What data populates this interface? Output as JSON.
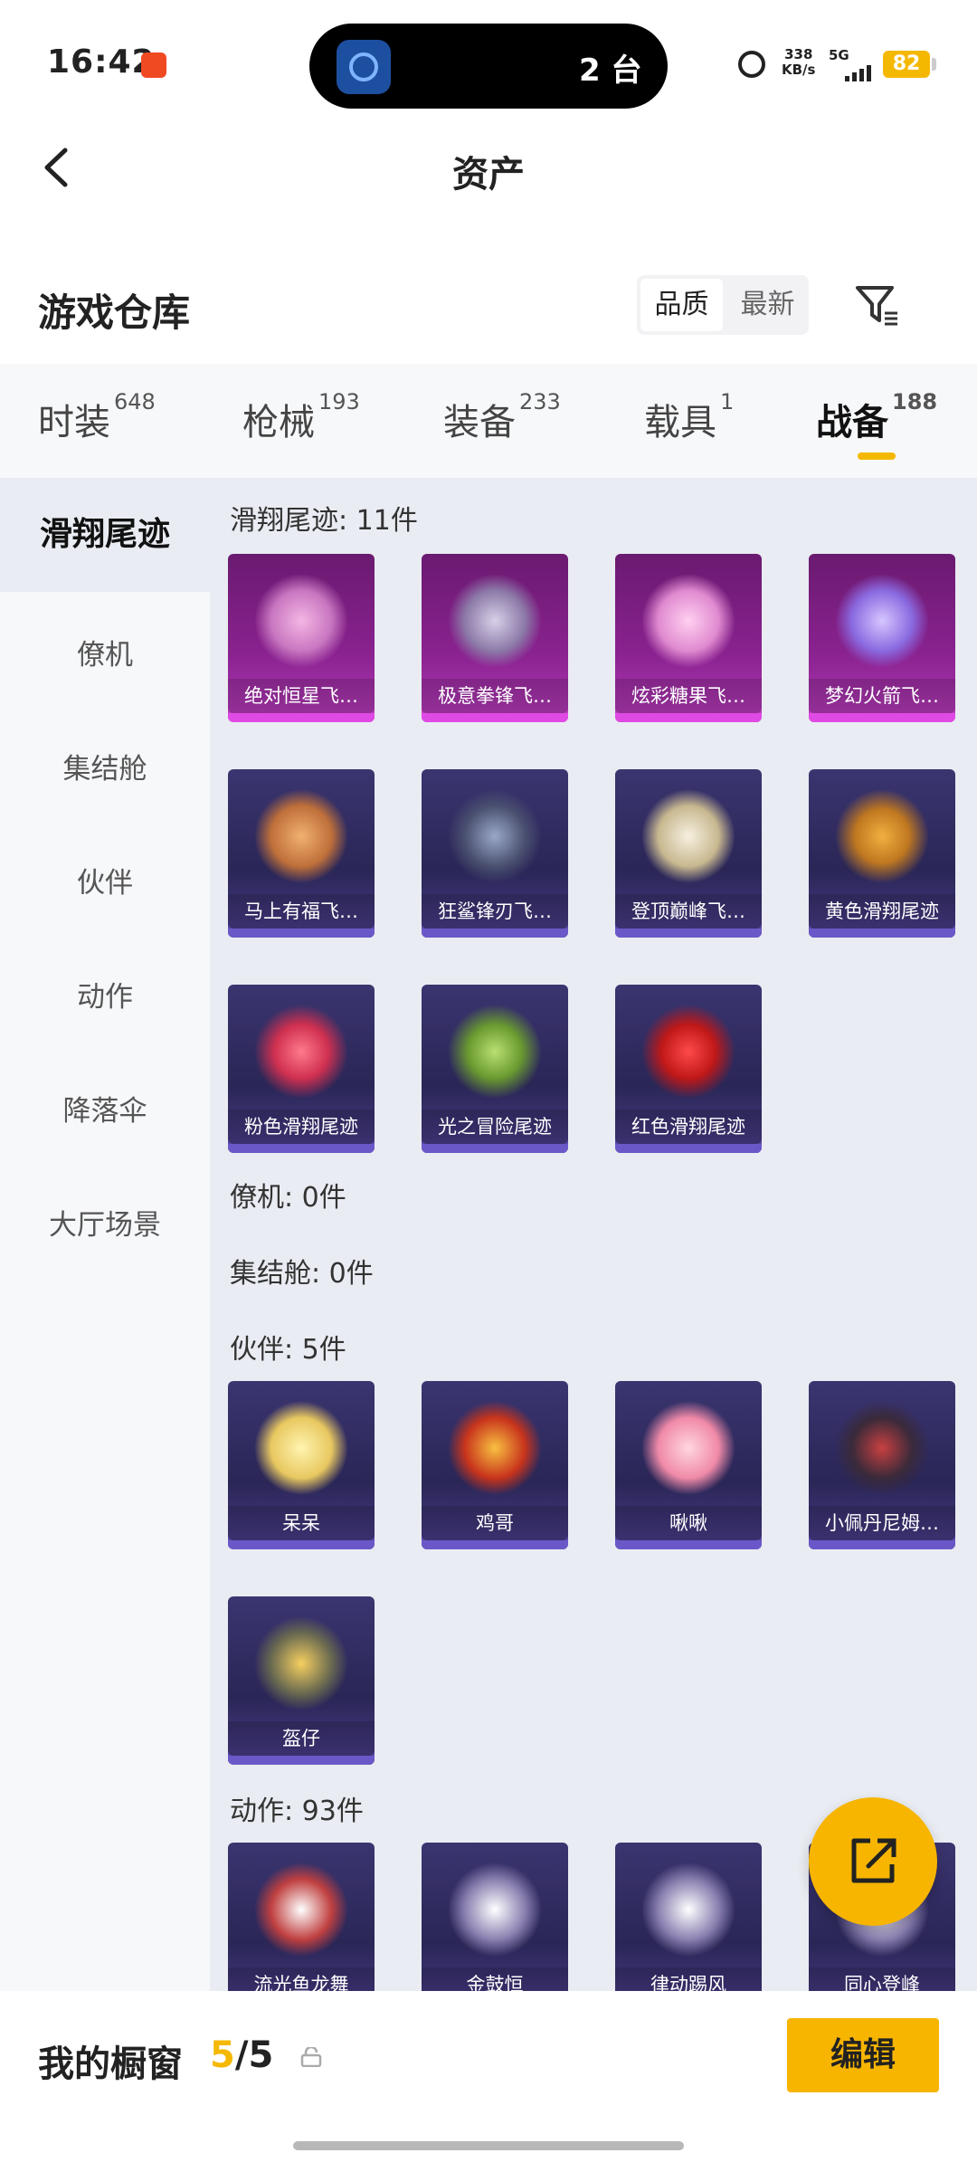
{
  "status_bar": {
    "time": "16:42",
    "island_text": "2 台",
    "net_speed": "338",
    "net_speed_unit": "KB/s",
    "net_type": "5G",
    "battery": "82"
  },
  "header": {
    "title": "资产"
  },
  "section": {
    "title": "游戏仓库",
    "sort_options": [
      "品质",
      "最新"
    ]
  },
  "tabs": [
    {
      "label": "时装",
      "count": "648"
    },
    {
      "label": "枪械",
      "count": "193"
    },
    {
      "label": "装备",
      "count": "233"
    },
    {
      "label": "载具",
      "count": "1"
    },
    {
      "label": "战备",
      "count": "188"
    }
  ],
  "sidebar": [
    "滑翔尾迹",
    "僚机",
    "集结舱",
    "伙伴",
    "动作",
    "降落伞",
    "大厅场景"
  ],
  "groups": {
    "trails": {
      "title": "滑翔尾迹: 11件",
      "items": [
        "绝对恒星飞…",
        "极意拳锋飞…",
        "炫彩糖果飞…",
        "梦幻火箭飞…",
        "马上有福飞…",
        "狂鲨锋刃飞…",
        "登顶巅峰飞…",
        "黄色滑翔尾迹",
        "粉色滑翔尾迹",
        "光之冒险尾迹",
        "红色滑翔尾迹"
      ]
    },
    "wingman": {
      "title": "僚机: 0件"
    },
    "pod": {
      "title": "集结舱: 0件"
    },
    "partner": {
      "title": "伙伴: 5件",
      "items": [
        "呆呆",
        "鸡哥",
        "啾啾",
        "小佩丹尼姆…",
        "盔仔"
      ]
    },
    "emote": {
      "title": "动作: 93件",
      "items": [
        "流光鱼龙舞",
        "金鼓恒",
        "律动踢风",
        "同心登峰"
      ]
    }
  },
  "bottom": {
    "showcase_label": "我的橱窗",
    "showcase_used": "5",
    "showcase_total": "/5",
    "edit_label": "编辑"
  },
  "colors": {
    "accent": "#f5b800",
    "purple_card": "#8a2290",
    "blue_card": "#2a2656"
  }
}
